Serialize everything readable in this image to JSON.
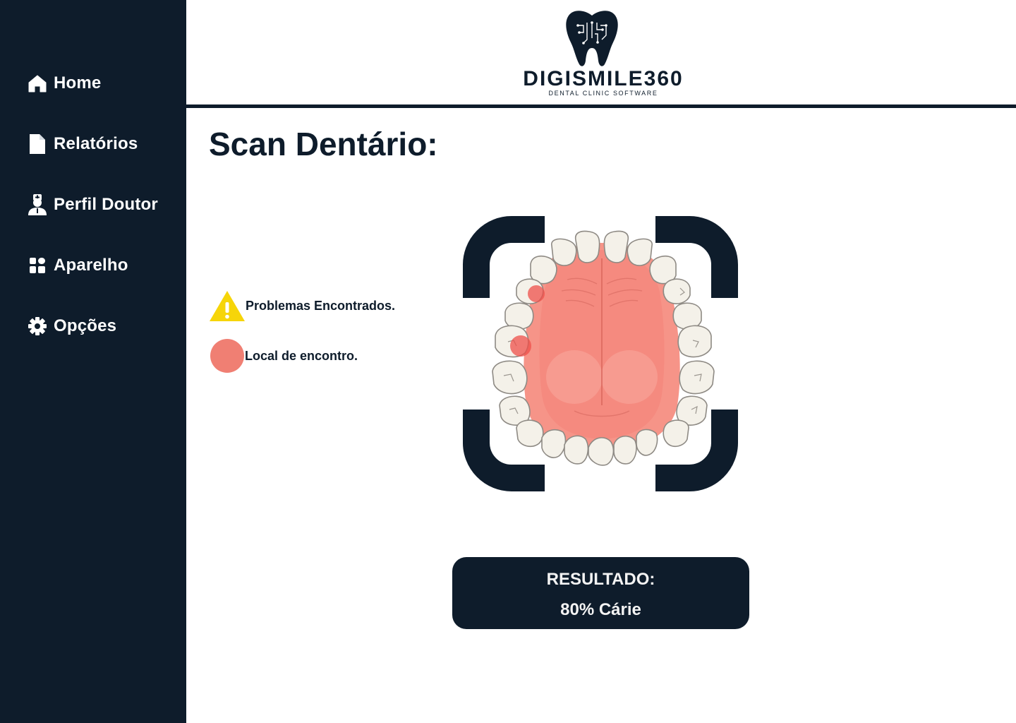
{
  "sidebar": {
    "items": [
      {
        "label": "Home",
        "icon": "home-icon"
      },
      {
        "label": "Relatórios",
        "icon": "document-icon"
      },
      {
        "label": "Perfil Doutor",
        "icon": "doctor-icon"
      },
      {
        "label": "Aparelho",
        "icon": "grid-icon"
      },
      {
        "label": "Opções",
        "icon": "gear-icon"
      }
    ]
  },
  "header": {
    "logo_word": "DIGISMILE360",
    "logo_tagline": "DENTAL CLINIC SOFTWARE"
  },
  "main": {
    "title": "Scan Dentário:",
    "legend": {
      "problems": "Problemas Encontrados.",
      "location": "Local de encontro."
    },
    "result": {
      "label": "RESULTADO:",
      "value": "80% Cárie"
    }
  },
  "colors": {
    "navy": "#0e1c2b",
    "warning": "#f6d509",
    "marker": "#f07f73",
    "gums": "#f69488",
    "tooth": "#f4f1e9"
  }
}
